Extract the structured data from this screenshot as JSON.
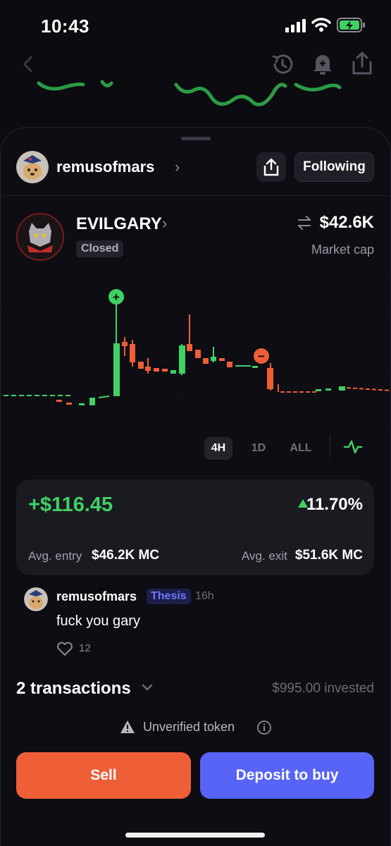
{
  "status_bar": {
    "time": "10:43"
  },
  "nav": {
    "back_icon": "chevron-left-icon",
    "history_icon": "history-icon",
    "bell_icon": "bell-plus-icon",
    "share_icon": "share-icon"
  },
  "profile": {
    "username": "remusofmars",
    "follow_label": "Following"
  },
  "token": {
    "name": "EVILGARY",
    "status": "Closed",
    "market_cap": "$42.6K",
    "market_cap_label": "Market cap"
  },
  "timeframes": [
    {
      "label": "4H",
      "active": true
    },
    {
      "label": "1D",
      "active": false
    },
    {
      "label": "ALL",
      "active": false
    }
  ],
  "chart_markers": {
    "buy": "+",
    "sell": "−"
  },
  "trade": {
    "pnl": "+$116.45",
    "pct": "11.70%",
    "avg_entry_label": "Avg. entry",
    "avg_entry_value": "$46.2K MC",
    "avg_exit_label": "Avg. exit",
    "avg_exit_value": "$51.6K MC"
  },
  "comment": {
    "author": "remusofmars",
    "tag": "Thesis",
    "time_ago": "16h",
    "text": "fuck you gary",
    "likes": "12"
  },
  "transactions": {
    "title": "2 transactions",
    "invested": "$995.00 invested"
  },
  "warning": {
    "text": "Unverified token"
  },
  "actions": {
    "sell": "Sell",
    "buy": "Deposit to buy"
  },
  "colors": {
    "green": "#3fd163",
    "red": "#ee5f37",
    "blue": "#5764f5"
  }
}
